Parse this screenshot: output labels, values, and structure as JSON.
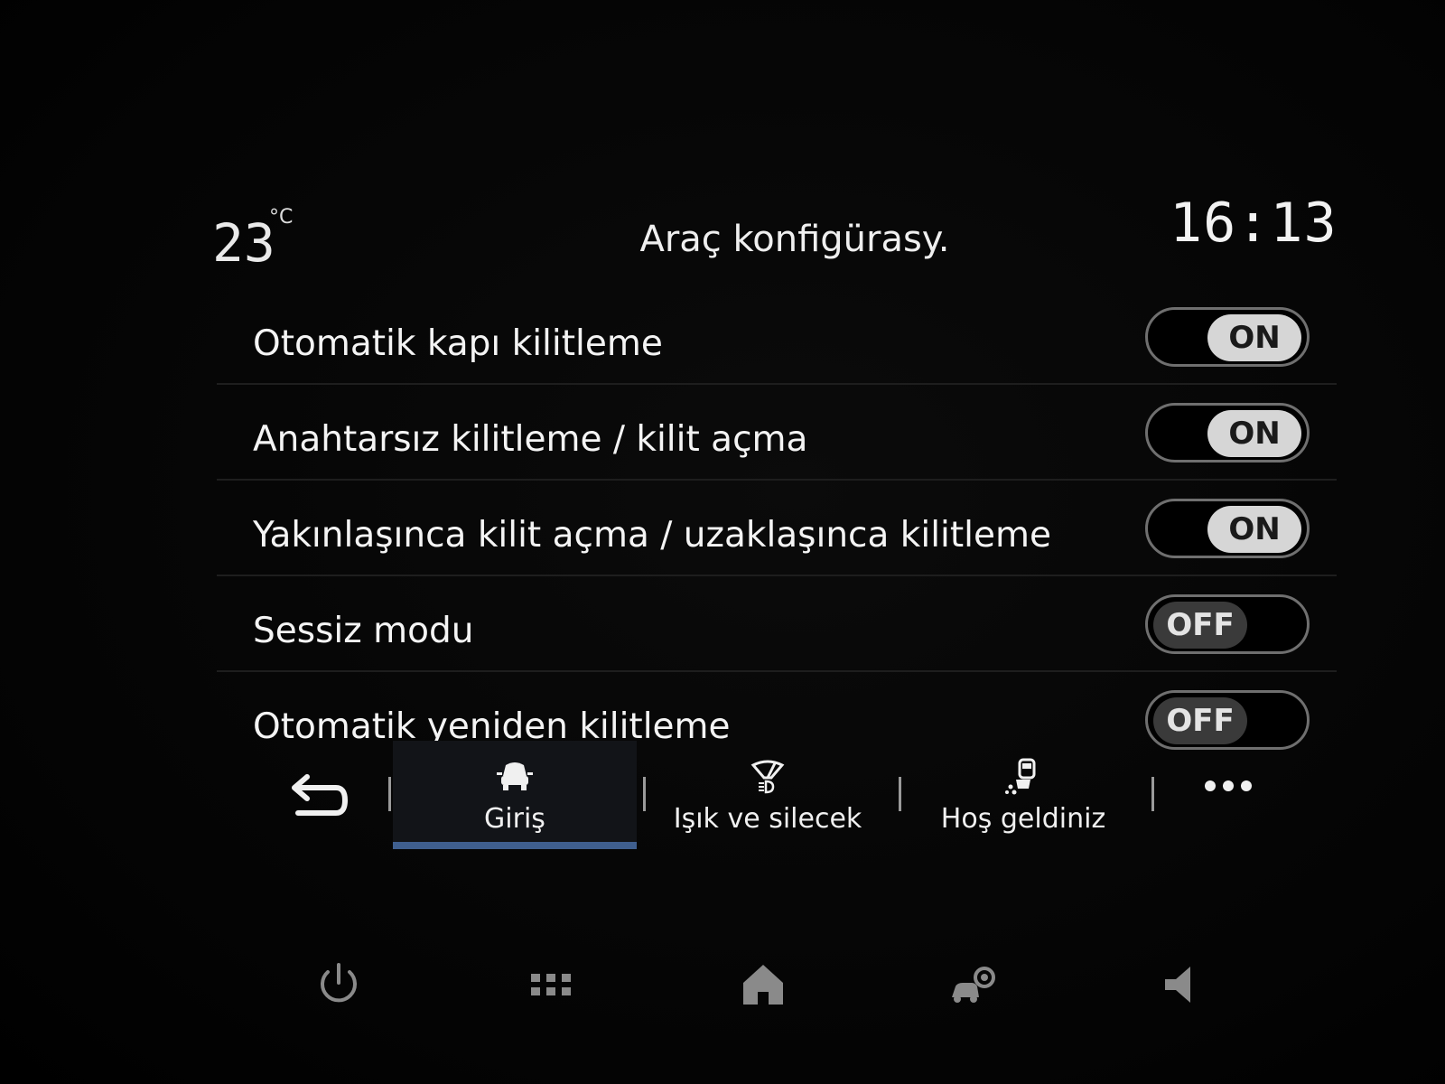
{
  "status": {
    "temperature": "23",
    "temperature_unit": "°C",
    "title": "Araç konfigürasy.",
    "time": "16:13"
  },
  "settings": [
    {
      "label": "Otomatik kapı kilitleme",
      "state": "ON"
    },
    {
      "label": "Anahtarsız kilitleme / kilit açma",
      "state": "ON"
    },
    {
      "label": "Yakınlaşınca kilit açma / uzaklaşınca kilitleme",
      "state": "ON"
    },
    {
      "label": "Sessiz modu",
      "state": "OFF"
    },
    {
      "label": "Otomatik yeniden kilitleme",
      "state": "OFF"
    }
  ],
  "tabs": [
    {
      "label": "Giriş",
      "icon": "car-front-icon",
      "active": true
    },
    {
      "label": "Işık ve silecek",
      "icon": "headlight-wiper-icon",
      "active": false
    },
    {
      "label": "Hoş geldiniz",
      "icon": "welcome-person-car-icon",
      "active": false
    }
  ],
  "bottom_bar": [
    "power-icon",
    "apps-grid-icon",
    "home-icon",
    "car-settings-icon",
    "volume-icon"
  ],
  "colors": {
    "background": "#050505",
    "toggle_on_knob": "#d6d6d6",
    "toggle_off_knob": "#3a3a3a",
    "active_tab_underline": "#3f5f8f"
  }
}
